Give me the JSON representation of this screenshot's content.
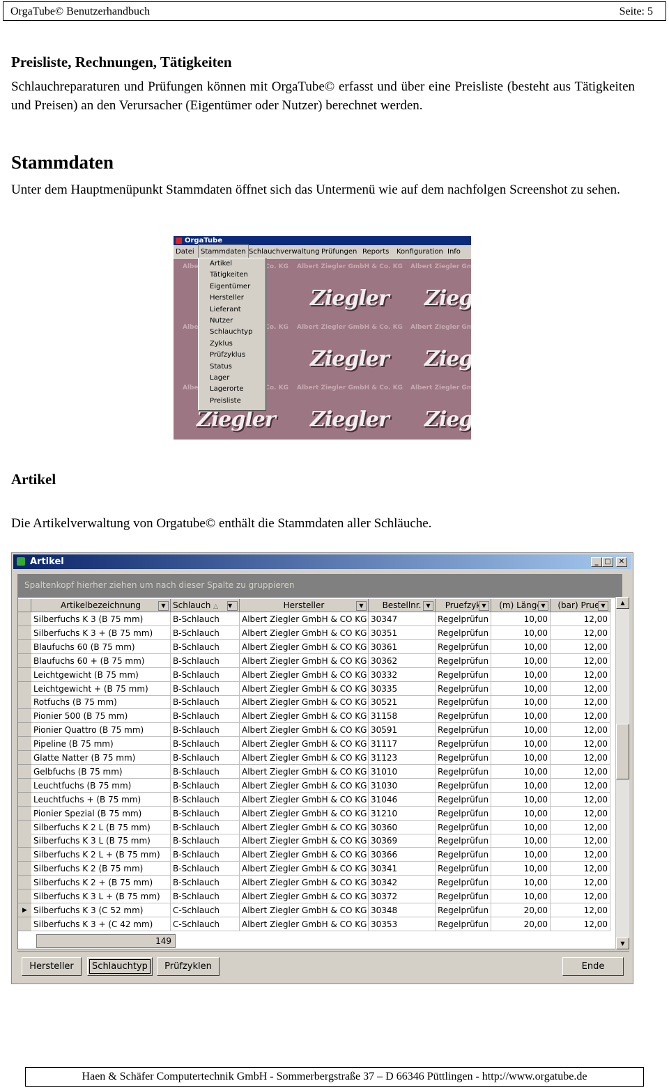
{
  "header": {
    "left": "OrgaTube© Benutzerhandbuch",
    "right": "Seite: 5"
  },
  "section1": {
    "title": "Preisliste, Rechnungen, Tätigkeiten",
    "text": "Schlauchreparaturen und Prüfungen können mit OrgaTube© erfasst und über eine Preisliste (besteht aus Tätigkeiten und Preisen) an den Verursacher (Eigentümer oder Nutzer) berechnet werden."
  },
  "section2": {
    "title": "Stammdaten",
    "text": "Unter dem Hauptmenüpunkt Stammdaten öffnet sich das Untermenü wie auf dem nachfolgen Screenshot zu sehen."
  },
  "shot1": {
    "title": "OrgaTube",
    "menu": [
      "Datei",
      "Stammdaten",
      "Schlauchverwaltung",
      "Prüfungen",
      "Reports",
      "Konfiguration",
      "Info"
    ],
    "submenu": [
      "Artikel",
      "Tätigkeiten",
      "Eigentümer",
      "Hersteller",
      "Lieferant",
      "Nutzer",
      "Schlauchtyp",
      "Zyklus",
      "Prüfzyklus",
      "Status",
      "Lager",
      "Lagerorte",
      "Preisliste"
    ],
    "bg_caption": "Albert Ziegler GmbH & Co. KG",
    "bg_logo": "Ziegler"
  },
  "section3": {
    "title": "Artikel",
    "text": "Die Artikelverwaltung von Orgatube© enthält die Stammdaten aller Schläuche."
  },
  "shot2": {
    "title": "Artikel",
    "group_hint": "Spaltenkopf hierher ziehen um nach dieser Spalte zu gruppieren",
    "columns": [
      "Artikelbezeichnung",
      "Schlauch",
      "Hersteller",
      "Bestellnr.",
      "Pruefzyk",
      "(m) Länge",
      "(bar) Pruef"
    ],
    "rows": [
      [
        "Silberfuchs K 3 (B 75 mm)",
        "B-Schlauch",
        "Albert Ziegler GmbH & CO KG",
        "30347",
        "Regelprüfun",
        "10,00",
        "12,00"
      ],
      [
        "Silberfuchs K 3 + (B 75 mm)",
        "B-Schlauch",
        "Albert Ziegler GmbH & CO KG",
        "30351",
        "Regelprüfun",
        "10,00",
        "12,00"
      ],
      [
        "Blaufuchs 60 (B 75 mm)",
        "B-Schlauch",
        "Albert Ziegler GmbH & CO KG",
        "30361",
        "Regelprüfun",
        "10,00",
        "12,00"
      ],
      [
        "Blaufuchs 60 + (B 75 mm)",
        "B-Schlauch",
        "Albert Ziegler GmbH & CO KG",
        "30362",
        "Regelprüfun",
        "10,00",
        "12,00"
      ],
      [
        "Leichtgewicht (B 75 mm)",
        "B-Schlauch",
        "Albert Ziegler GmbH & CO KG",
        "30332",
        "Regelprüfun",
        "10,00",
        "12,00"
      ],
      [
        "Leichtgewicht + (B 75 mm)",
        "B-Schlauch",
        "Albert Ziegler GmbH & CO KG",
        "30335",
        "Regelprüfun",
        "10,00",
        "12,00"
      ],
      [
        "Rotfuchs (B 75 mm)",
        "B-Schlauch",
        "Albert Ziegler GmbH & CO KG",
        "30521",
        "Regelprüfun",
        "10,00",
        "12,00"
      ],
      [
        "Pionier 500 (B 75 mm)",
        "B-Schlauch",
        "Albert Ziegler GmbH & CO KG",
        "31158",
        "Regelprüfun",
        "10,00",
        "12,00"
      ],
      [
        "Pionier Quattro (B 75 mm)",
        "B-Schlauch",
        "Albert Ziegler GmbH & CO KG",
        "30591",
        "Regelprüfun",
        "10,00",
        "12,00"
      ],
      [
        "Pipeline (B 75 mm)",
        "B-Schlauch",
        "Albert Ziegler GmbH & CO KG",
        "31117",
        "Regelprüfun",
        "10,00",
        "12,00"
      ],
      [
        "Glatte Natter (B 75 mm)",
        "B-Schlauch",
        "Albert Ziegler GmbH & CO KG",
        "31123",
        "Regelprüfun",
        "10,00",
        "12,00"
      ],
      [
        "Gelbfuchs (B 75 mm)",
        "B-Schlauch",
        "Albert Ziegler GmbH & CO KG",
        "31010",
        "Regelprüfun",
        "10,00",
        "12,00"
      ],
      [
        "Leuchtfuchs (B 75 mm)",
        "B-Schlauch",
        "Albert Ziegler GmbH & CO KG",
        "31030",
        "Regelprüfun",
        "10,00",
        "12,00"
      ],
      [
        "Leuchtfuchs + (B 75 mm)",
        "B-Schlauch",
        "Albert Ziegler GmbH & CO KG",
        "31046",
        "Regelprüfun",
        "10,00",
        "12,00"
      ],
      [
        "Pionier Spezial (B 75 mm)",
        "B-Schlauch",
        "Albert Ziegler GmbH & CO KG",
        "31210",
        "Regelprüfun",
        "10,00",
        "12,00"
      ],
      [
        "Silberfuchs K 2 L (B 75 mm)",
        "B-Schlauch",
        "Albert Ziegler GmbH & CO KG",
        "30360",
        "Regelprüfun",
        "10,00",
        "12,00"
      ],
      [
        "Silberfuchs K 3 L (B 75 mm)",
        "B-Schlauch",
        "Albert Ziegler GmbH & CO KG",
        "30369",
        "Regelprüfun",
        "10,00",
        "12,00"
      ],
      [
        "Silberfuchs K 2 L + (B 75 mm)",
        "B-Schlauch",
        "Albert Ziegler GmbH & CO KG",
        "30366",
        "Regelprüfun",
        "10,00",
        "12,00"
      ],
      [
        "Silberfuchs K 2 (B 75 mm)",
        "B-Schlauch",
        "Albert Ziegler GmbH & CO KG",
        "30341",
        "Regelprüfun",
        "10,00",
        "12,00"
      ],
      [
        "Silberfuchs K 2 + (B 75 mm)",
        "B-Schlauch",
        "Albert Ziegler GmbH & CO KG",
        "30342",
        "Regelprüfun",
        "10,00",
        "12,00"
      ],
      [
        "Silberfuchs K 3 L + (B 75 mm)",
        "B-Schlauch",
        "Albert Ziegler GmbH & CO KG",
        "30372",
        "Regelprüfun",
        "10,00",
        "12,00"
      ],
      [
        "Silberfuchs K 3 (C 52 mm)",
        "C-Schlauch",
        "Albert Ziegler GmbH & CO KG",
        "30348",
        "Regelprüfun",
        "20,00",
        "12,00"
      ],
      [
        "Silberfuchs K 3 + (C 42 mm)",
        "C-Schlauch",
        "Albert Ziegler GmbH & CO KG",
        "30353",
        "Regelprüfun",
        "20,00",
        "12,00"
      ]
    ],
    "current_row_marker": "▶",
    "record_count": "149",
    "buttons": {
      "hersteller": "Hersteller",
      "schlauchtyp": "Schlauchtyp",
      "pruefzyklen": "Prüfzyklen",
      "ende": "Ende"
    }
  },
  "footer": "Haen & Schäfer Computertechnik GmbH - Sommerbergstraße 37 – D 66346 Püttlingen - http://www.orgatube.de"
}
